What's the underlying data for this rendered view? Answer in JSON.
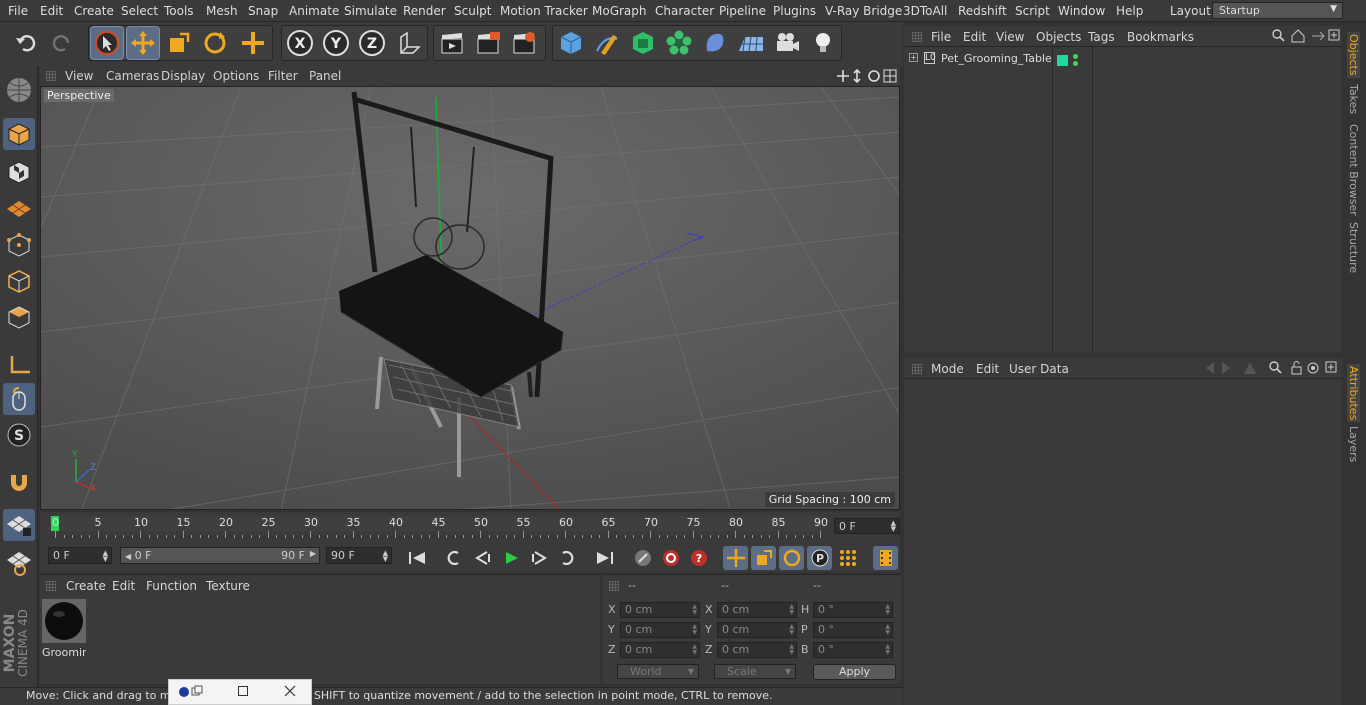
{
  "menu": [
    "File",
    "Edit",
    "Create",
    "Select",
    "Tools",
    "Mesh",
    "Snap",
    "Animate",
    "Simulate",
    "Render",
    "Sculpt",
    "Motion Tracker",
    "MoGraph",
    "Character",
    "Pipeline",
    "Plugins",
    "V-Ray Bridge",
    "3DToAll",
    "Redshift",
    "Script",
    "Window",
    "Help"
  ],
  "layout": {
    "label": "Layout:",
    "value": "Startup"
  },
  "viewport": {
    "menu": [
      "View",
      "Cameras",
      "Display",
      "Options",
      "Filter",
      "Panel"
    ],
    "name": "Perspective",
    "grid_spacing": "Grid Spacing : 100 cm"
  },
  "timeline": {
    "ticks": [
      "0",
      "5",
      "10",
      "15",
      "20",
      "25",
      "30",
      "35",
      "40",
      "45",
      "50",
      "55",
      "60",
      "65",
      "70",
      "75",
      "80",
      "85",
      "90"
    ],
    "current_frame": "0 F"
  },
  "transport": {
    "start": "0 F",
    "range_start": "0 F",
    "range_end": "90 F",
    "end": "90 F"
  },
  "material_panel": {
    "menu": [
      "Create",
      "Edit",
      "Function",
      "Texture"
    ],
    "material_name": "Groomin"
  },
  "coords": {
    "headers": [
      "--",
      "--",
      "--"
    ],
    "rows": [
      {
        "l1": "X",
        "v1": "0 cm",
        "l2": "X",
        "v2": "0 cm",
        "l3": "H",
        "v3": "0 °"
      },
      {
        "l1": "Y",
        "v1": "0 cm",
        "l2": "Y",
        "v2": "0 cm",
        "l3": "P",
        "v3": "0 °"
      },
      {
        "l1": "Z",
        "v1": "0 cm",
        "l2": "Z",
        "v2": "0 cm",
        "l3": "B",
        "v3": "0 °"
      }
    ],
    "space": "World",
    "mode": "Scale",
    "apply": "Apply"
  },
  "object_manager": {
    "menu": [
      "File",
      "Edit",
      "View",
      "Objects",
      "Tags",
      "Bookmarks"
    ],
    "object": "Pet_Grooming_Table"
  },
  "attributes": {
    "menu": [
      "Mode",
      "Edit",
      "User Data"
    ]
  },
  "side_tabs": [
    "Objects",
    "Takes",
    "Content Browser",
    "Structure",
    "Attributes",
    "Layers"
  ],
  "status": "Move: Click and drag to move elements. Hold down SHIFT to quantize movement / add to the selection in point mode, CTRL to remove.",
  "brand": {
    "line1": "MAXON",
    "line2": "CINEMA 4D"
  },
  "colors": {
    "accent": "#5d6d86",
    "tag_green": "#1fd8a0",
    "play": "#2ecc40"
  }
}
